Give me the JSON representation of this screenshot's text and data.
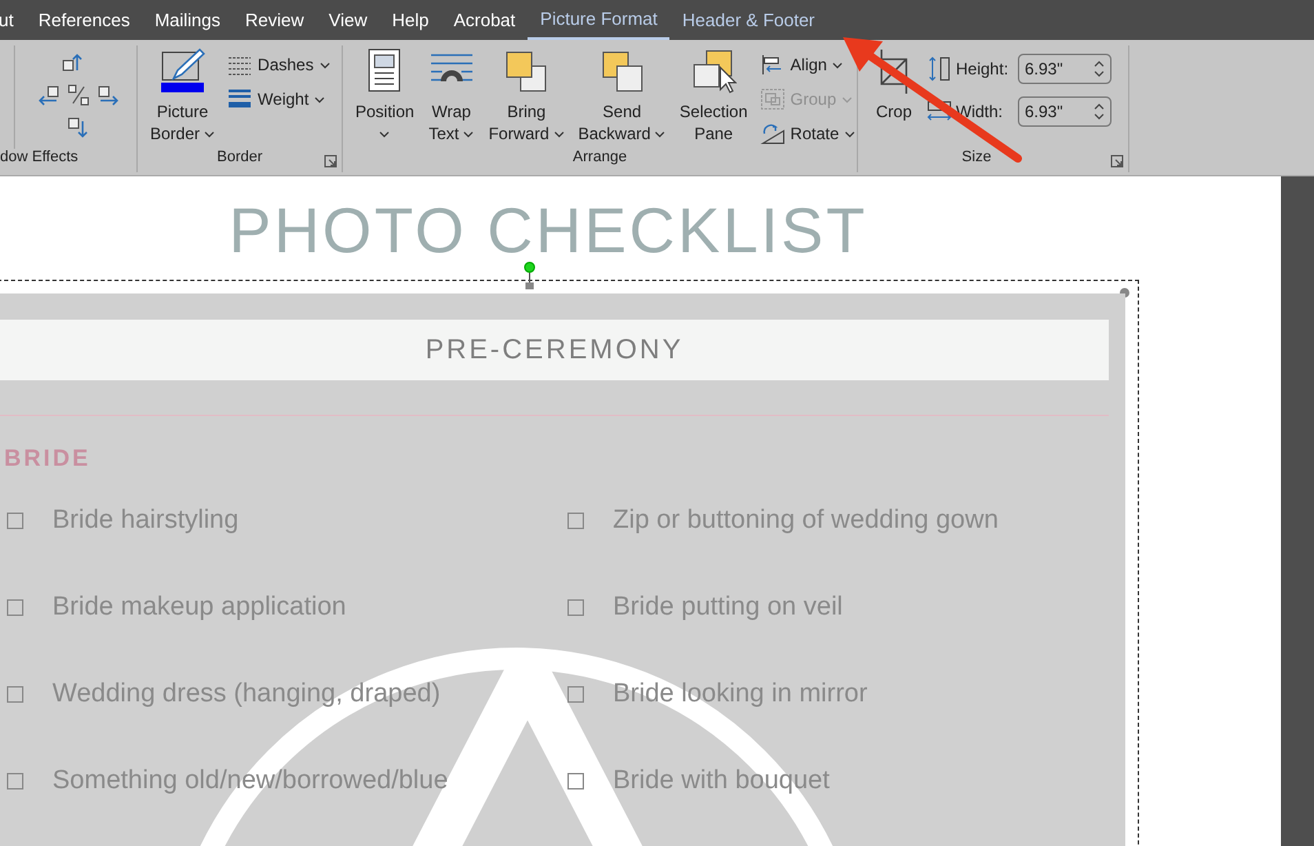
{
  "tabs": [
    {
      "label": "ut",
      "selected": false,
      "contextual": false
    },
    {
      "label": "References",
      "selected": false,
      "contextual": false
    },
    {
      "label": "Mailings",
      "selected": false,
      "contextual": false
    },
    {
      "label": "Review",
      "selected": false,
      "contextual": false
    },
    {
      "label": "View",
      "selected": false,
      "contextual": false
    },
    {
      "label": "Help",
      "selected": false,
      "contextual": false
    },
    {
      "label": "Acrobat",
      "selected": false,
      "contextual": false
    },
    {
      "label": "Picture Format",
      "selected": true,
      "contextual": true
    },
    {
      "label": "Header & Footer",
      "selected": false,
      "contextual": true
    }
  ],
  "ribbon": {
    "groups": [
      {
        "label": "dow Effects"
      },
      {
        "label": "Border",
        "dialog": true,
        "items": [
          {
            "kind": "large",
            "lines": [
              "Picture",
              "Border"
            ],
            "dropdown": true
          },
          {
            "kind": "small",
            "label": "Dashes",
            "dropdown": true
          },
          {
            "kind": "small",
            "label": "Weight",
            "dropdown": true
          }
        ]
      },
      {
        "label": "Arrange",
        "items": [
          {
            "kind": "large",
            "lines": [
              "Position"
            ],
            "dropdown": true
          },
          {
            "kind": "large",
            "lines": [
              "Wrap",
              "Text"
            ],
            "dropdown": true
          },
          {
            "kind": "large",
            "lines": [
              "Bring",
              "Forward"
            ],
            "dropdown": true
          },
          {
            "kind": "large",
            "lines": [
              "Send",
              "Backward"
            ],
            "dropdown": true
          },
          {
            "kind": "large",
            "lines": [
              "Selection",
              "Pane"
            ]
          },
          {
            "kind": "small",
            "label": "Align",
            "dropdown": true
          },
          {
            "kind": "small",
            "label": "Group",
            "dropdown": true,
            "disabled": true
          },
          {
            "kind": "small",
            "label": "Rotate",
            "dropdown": true
          }
        ]
      },
      {
        "label": "Size",
        "dialog": true,
        "items": [
          {
            "kind": "large",
            "lines": [
              "Crop"
            ]
          },
          {
            "kind": "field",
            "label": "Height:",
            "value": "6.93\""
          },
          {
            "kind": "field",
            "label": "Width:",
            "value": "6.93\""
          }
        ]
      }
    ]
  },
  "document": {
    "title": "PHOTO CHECKLIST",
    "section": "PRE-CEREMONY",
    "category": "BRIDE",
    "items": [
      {
        "label": "Bride hairstyling",
        "checked": false
      },
      {
        "label": "Zip or buttoning of wedding gown",
        "checked": false
      },
      {
        "label": "Bride makeup application",
        "checked": false
      },
      {
        "label": "Bride putting on veil",
        "checked": false
      },
      {
        "label": "Wedding dress (hanging, draped)",
        "checked": false
      },
      {
        "label": "Bride looking in mirror",
        "checked": false
      },
      {
        "label": "Something old/new/borrowed/blue",
        "checked": false
      },
      {
        "label": "Bride with bouquet",
        "checked": false
      }
    ]
  }
}
